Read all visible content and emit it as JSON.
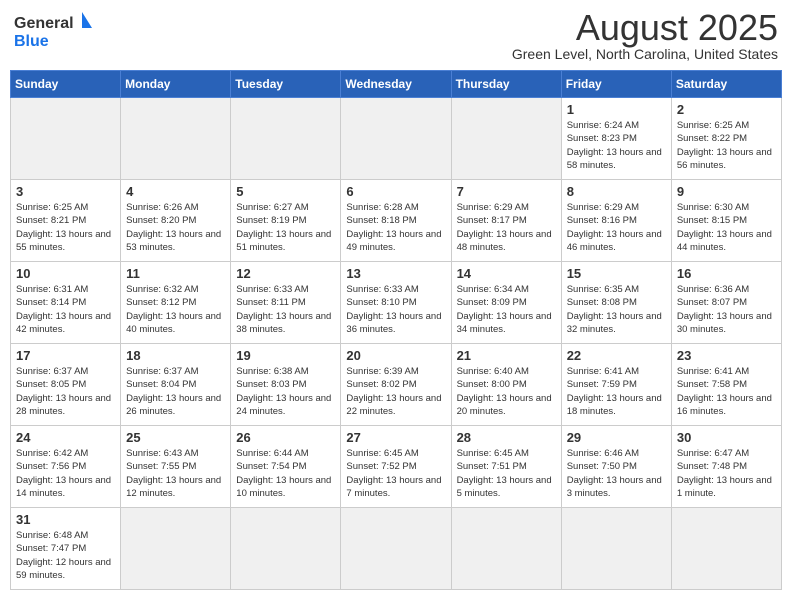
{
  "header": {
    "logo_general": "General",
    "logo_blue": "Blue",
    "month_title": "August 2025",
    "location": "Green Level, North Carolina, United States"
  },
  "days_of_week": [
    "Sunday",
    "Monday",
    "Tuesday",
    "Wednesday",
    "Thursday",
    "Friday",
    "Saturday"
  ],
  "weeks": [
    [
      {
        "day": "",
        "info": ""
      },
      {
        "day": "",
        "info": ""
      },
      {
        "day": "",
        "info": ""
      },
      {
        "day": "",
        "info": ""
      },
      {
        "day": "",
        "info": ""
      },
      {
        "day": "1",
        "info": "Sunrise: 6:24 AM\nSunset: 8:23 PM\nDaylight: 13 hours and 58 minutes."
      },
      {
        "day": "2",
        "info": "Sunrise: 6:25 AM\nSunset: 8:22 PM\nDaylight: 13 hours and 56 minutes."
      }
    ],
    [
      {
        "day": "3",
        "info": "Sunrise: 6:25 AM\nSunset: 8:21 PM\nDaylight: 13 hours and 55 minutes."
      },
      {
        "day": "4",
        "info": "Sunrise: 6:26 AM\nSunset: 8:20 PM\nDaylight: 13 hours and 53 minutes."
      },
      {
        "day": "5",
        "info": "Sunrise: 6:27 AM\nSunset: 8:19 PM\nDaylight: 13 hours and 51 minutes."
      },
      {
        "day": "6",
        "info": "Sunrise: 6:28 AM\nSunset: 8:18 PM\nDaylight: 13 hours and 49 minutes."
      },
      {
        "day": "7",
        "info": "Sunrise: 6:29 AM\nSunset: 8:17 PM\nDaylight: 13 hours and 48 minutes."
      },
      {
        "day": "8",
        "info": "Sunrise: 6:29 AM\nSunset: 8:16 PM\nDaylight: 13 hours and 46 minutes."
      },
      {
        "day": "9",
        "info": "Sunrise: 6:30 AM\nSunset: 8:15 PM\nDaylight: 13 hours and 44 minutes."
      }
    ],
    [
      {
        "day": "10",
        "info": "Sunrise: 6:31 AM\nSunset: 8:14 PM\nDaylight: 13 hours and 42 minutes."
      },
      {
        "day": "11",
        "info": "Sunrise: 6:32 AM\nSunset: 8:12 PM\nDaylight: 13 hours and 40 minutes."
      },
      {
        "day": "12",
        "info": "Sunrise: 6:33 AM\nSunset: 8:11 PM\nDaylight: 13 hours and 38 minutes."
      },
      {
        "day": "13",
        "info": "Sunrise: 6:33 AM\nSunset: 8:10 PM\nDaylight: 13 hours and 36 minutes."
      },
      {
        "day": "14",
        "info": "Sunrise: 6:34 AM\nSunset: 8:09 PM\nDaylight: 13 hours and 34 minutes."
      },
      {
        "day": "15",
        "info": "Sunrise: 6:35 AM\nSunset: 8:08 PM\nDaylight: 13 hours and 32 minutes."
      },
      {
        "day": "16",
        "info": "Sunrise: 6:36 AM\nSunset: 8:07 PM\nDaylight: 13 hours and 30 minutes."
      }
    ],
    [
      {
        "day": "17",
        "info": "Sunrise: 6:37 AM\nSunset: 8:05 PM\nDaylight: 13 hours and 28 minutes."
      },
      {
        "day": "18",
        "info": "Sunrise: 6:37 AM\nSunset: 8:04 PM\nDaylight: 13 hours and 26 minutes."
      },
      {
        "day": "19",
        "info": "Sunrise: 6:38 AM\nSunset: 8:03 PM\nDaylight: 13 hours and 24 minutes."
      },
      {
        "day": "20",
        "info": "Sunrise: 6:39 AM\nSunset: 8:02 PM\nDaylight: 13 hours and 22 minutes."
      },
      {
        "day": "21",
        "info": "Sunrise: 6:40 AM\nSunset: 8:00 PM\nDaylight: 13 hours and 20 minutes."
      },
      {
        "day": "22",
        "info": "Sunrise: 6:41 AM\nSunset: 7:59 PM\nDaylight: 13 hours and 18 minutes."
      },
      {
        "day": "23",
        "info": "Sunrise: 6:41 AM\nSunset: 7:58 PM\nDaylight: 13 hours and 16 minutes."
      }
    ],
    [
      {
        "day": "24",
        "info": "Sunrise: 6:42 AM\nSunset: 7:56 PM\nDaylight: 13 hours and 14 minutes."
      },
      {
        "day": "25",
        "info": "Sunrise: 6:43 AM\nSunset: 7:55 PM\nDaylight: 13 hours and 12 minutes."
      },
      {
        "day": "26",
        "info": "Sunrise: 6:44 AM\nSunset: 7:54 PM\nDaylight: 13 hours and 10 minutes."
      },
      {
        "day": "27",
        "info": "Sunrise: 6:45 AM\nSunset: 7:52 PM\nDaylight: 13 hours and 7 minutes."
      },
      {
        "day": "28",
        "info": "Sunrise: 6:45 AM\nSunset: 7:51 PM\nDaylight: 13 hours and 5 minutes."
      },
      {
        "day": "29",
        "info": "Sunrise: 6:46 AM\nSunset: 7:50 PM\nDaylight: 13 hours and 3 minutes."
      },
      {
        "day": "30",
        "info": "Sunrise: 6:47 AM\nSunset: 7:48 PM\nDaylight: 13 hours and 1 minute."
      }
    ],
    [
      {
        "day": "31",
        "info": "Sunrise: 6:48 AM\nSunset: 7:47 PM\nDaylight: 12 hours and 59 minutes."
      },
      {
        "day": "",
        "info": ""
      },
      {
        "day": "",
        "info": ""
      },
      {
        "day": "",
        "info": ""
      },
      {
        "day": "",
        "info": ""
      },
      {
        "day": "",
        "info": ""
      },
      {
        "day": "",
        "info": ""
      }
    ]
  ]
}
